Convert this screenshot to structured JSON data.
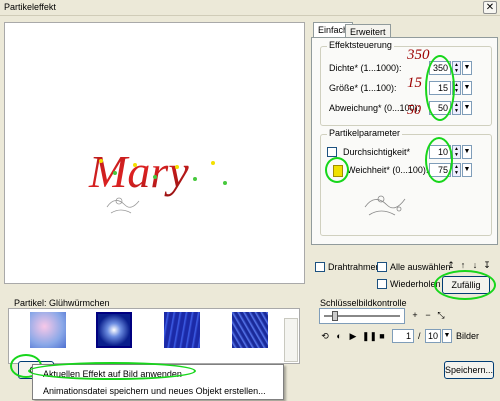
{
  "window": {
    "title": "Partikeleffekt",
    "close_glyph": "✕"
  },
  "tabs": [
    {
      "label": "Einfach"
    },
    {
      "label": "Erweitert"
    }
  ],
  "effektsteuerung": {
    "title": "Effektsteuerung",
    "rows": [
      {
        "label": "Dichte* (1...1000):",
        "value": "350"
      },
      {
        "label": "Größe* (1...100):",
        "value": "15"
      },
      {
        "label": "Abweichung* (0...100):",
        "value": "50"
      }
    ],
    "handwritten": [
      "350",
      "15",
      "50"
    ]
  },
  "partikelparameter": {
    "title": "Partikelparameter",
    "rows": [
      {
        "label": "Durchsichtigkeit*",
        "value": "10"
      },
      {
        "label": "Weichheit* (0...100):",
        "value": "75"
      }
    ],
    "color_swatch": "#f0e000"
  },
  "checkboxes": {
    "drahtrahmen": "Drahtrahmen",
    "alle_auswaehlen": "Alle auswählen",
    "wiederholen": "Wiederholen"
  },
  "buttons": {
    "zufaellig": "Zufällig",
    "speichern": "Speichern...",
    "ok": "OK"
  },
  "partikel": {
    "label": "Partikel: Glühwürmchen"
  },
  "keyframe": {
    "label": "Schlüsselbildkontrolle",
    "frame": "1",
    "total": "10",
    "unit": "Bilder",
    "separator": "/"
  },
  "preview_text": "Mary",
  "context_menu": {
    "items": [
      "Aktuellen Effekt auf Bild anwenden",
      "Animationsdatei speichern und neues Objekt erstellen..."
    ]
  },
  "colors": {
    "highlight": "#17d61b",
    "accent": "#9c0000"
  }
}
